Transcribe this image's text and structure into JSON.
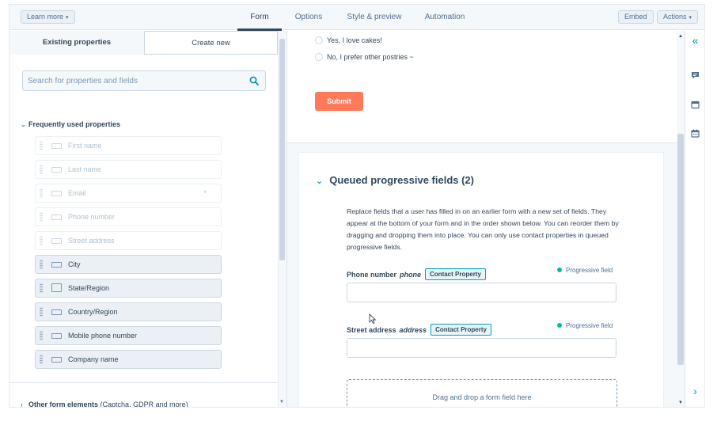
{
  "topbar": {
    "learn_more": "Learn more",
    "tabs": [
      {
        "label": "Form",
        "active": true
      },
      {
        "label": "Options",
        "active": false
      },
      {
        "label": "Style & preview",
        "active": false
      },
      {
        "label": "Automation",
        "active": false
      }
    ],
    "embed": "Embed",
    "actions": "Actions"
  },
  "left_panel": {
    "tabs": [
      "Existing properties",
      "Create new"
    ],
    "search_placeholder": "Search for properties and fields",
    "frequent_heading": "Frequently used properties",
    "fields": [
      {
        "label": "First name",
        "enabled": false
      },
      {
        "label": "Last name",
        "enabled": false
      },
      {
        "label": "Email",
        "enabled": false,
        "required_mark": "*"
      },
      {
        "label": "Phone number",
        "enabled": false
      },
      {
        "label": "Street address",
        "enabled": false
      },
      {
        "label": "City",
        "enabled": true
      },
      {
        "label": "State/Region",
        "enabled": true
      },
      {
        "label": "Country/Region",
        "enabled": true
      },
      {
        "label": "Mobile phone number",
        "enabled": true
      },
      {
        "label": "Company name",
        "enabled": true
      }
    ],
    "other_heading": "Other form elements",
    "other_heading_note": "(Captcha, GDPR and more)"
  },
  "preview": {
    "radio_options": [
      "Yes, I love cakes!",
      "No, I prefer other postries ~"
    ],
    "submit": "Submit"
  },
  "queued": {
    "title": "Queued progressive fields (2)",
    "description": "Replace fields that a user has filled in on an earlier form with a new set of fields. They appear at the bottom of your form and in the order shown below. You can reorder them by dragging and dropping them into place. You can only use contact properties in queued progressive fields.",
    "fields": [
      {
        "label": "Phone number",
        "internal": "phone",
        "badge": "Contact Property",
        "status": "Progressive field"
      },
      {
        "label": "Street address",
        "internal": "address",
        "badge": "Contact Property",
        "status": "Progressive field"
      }
    ],
    "dropzone": "Drag and drop a form field here"
  },
  "colors": {
    "accent": "#ff7a59",
    "teal": "#00a4bd",
    "progress_dot": "#00bda5",
    "text": "#33475b"
  }
}
